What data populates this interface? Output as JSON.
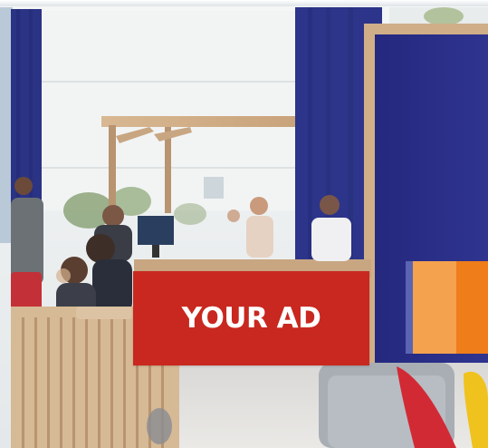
{
  "ad": {
    "label": "YOUR AD",
    "background_color": "#c8281f",
    "text_color": "#ffffff"
  },
  "accent": {
    "light_orange": "#f4a24e",
    "dark_orange": "#ef7d1a",
    "edge_blue": "#5a64b2"
  },
  "scene": {
    "panel_blue": "#2a2f8a",
    "wood_tone": "#c9a27c"
  }
}
